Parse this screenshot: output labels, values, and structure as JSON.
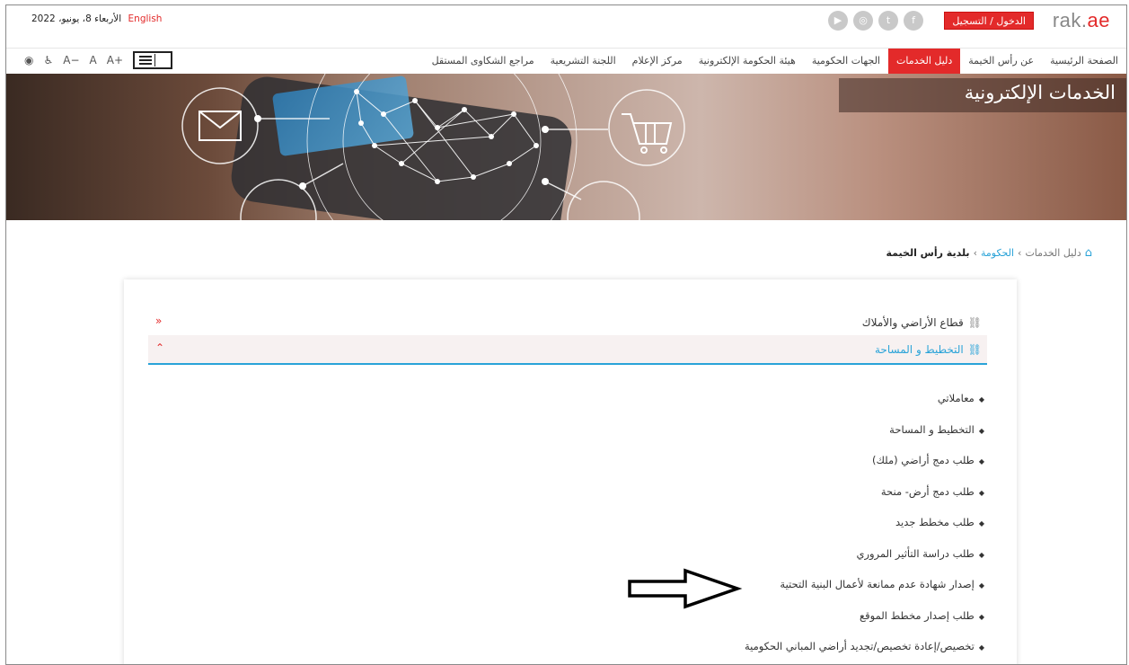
{
  "header": {
    "logo_main": "rak.",
    "logo_accent": "ae",
    "login_label": "الدخول / التسجيل",
    "date_text": "الأربعاء 8، يونيو، 2022",
    "language_label": "English",
    "social_icons": [
      "facebook-icon",
      "twitter-icon",
      "instagram-icon",
      "youtube-icon"
    ],
    "social_glyphs": [
      "f",
      "t",
      "◎",
      "▶"
    ]
  },
  "nav": {
    "items": [
      {
        "label": "الصفحة الرئيسية",
        "active": false
      },
      {
        "label": "عن رأس الخيمة",
        "active": false
      },
      {
        "label": "دليل الخدمات",
        "active": true
      },
      {
        "label": "الجهات الحكومية",
        "active": false
      },
      {
        "label": "هيئة الحكومة الإلكترونية",
        "active": false
      },
      {
        "label": "مركز الإعلام",
        "active": false
      },
      {
        "label": "اللجنة التشريعية",
        "active": false
      },
      {
        "label": "مراجع الشكاوى المستقل",
        "active": false
      }
    ],
    "a11y": {
      "eye": "◉",
      "person": "♿",
      "font_smaller": "A−",
      "font_normal": "A",
      "font_larger": "A+"
    }
  },
  "banner": {
    "title": "الخدمات الإلكترونية"
  },
  "breadcrumb": {
    "home_icon": "⌂",
    "level1": "دليل الخدمات",
    "level2": "الحكومة",
    "current": "بلدية رأس الخيمة",
    "separator": "›"
  },
  "accordion": {
    "section1": "قطاع الأراضي والأملاك",
    "section2": "التخطيط و المساحة",
    "chev_collapsed": "«",
    "chev_expanded": "⌃",
    "link_glyph": "⛓"
  },
  "services": [
    "معاملاتي",
    "التخطيط و المساحة",
    "طلب دمج أراضي (ملك)",
    "طلب دمج أرض- منحة",
    "طلب مخطط جديد",
    "طلب دراسة التأثير المروري",
    "إصدار شهادة عدم ممانعة لأعمال البنية التحتية",
    "طلب إصدار مخطط الموقع",
    "تخصيص/إعادة تخصيص/تجديد أراضي المباني الحكومية"
  ],
  "colors": {
    "brand_red": "#e32a2a",
    "link_blue": "#2aa3d8"
  }
}
